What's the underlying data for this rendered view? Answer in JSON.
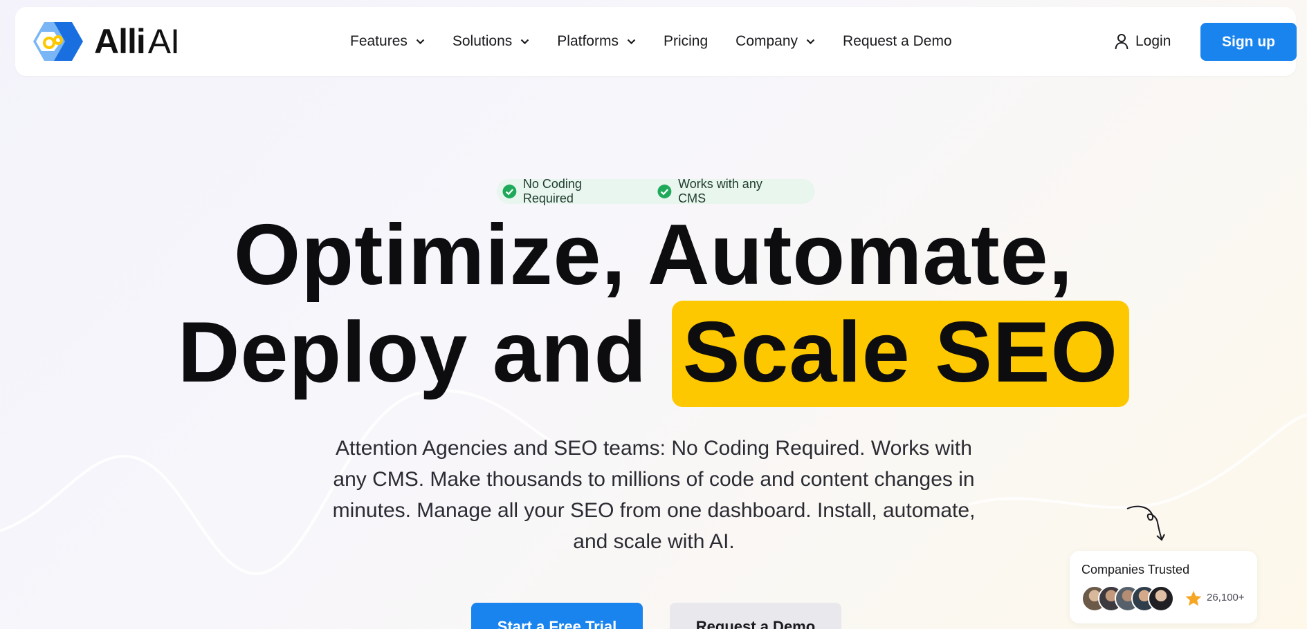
{
  "brand": {
    "name_main": "Alli",
    "name_ai": "AI"
  },
  "nav": {
    "items": [
      {
        "label": "Features",
        "has_dropdown": true
      },
      {
        "label": "Solutions",
        "has_dropdown": true
      },
      {
        "label": "Platforms",
        "has_dropdown": true
      },
      {
        "label": "Pricing",
        "has_dropdown": false
      },
      {
        "label": "Company",
        "has_dropdown": true
      },
      {
        "label": "Request a Demo",
        "has_dropdown": false
      }
    ],
    "login_label": "Login",
    "signup_label": "Sign up"
  },
  "badges": [
    {
      "label": "No Coding Required",
      "icon": "check-circle-icon"
    },
    {
      "label": "Works with any CMS",
      "icon": "check-circle-icon"
    }
  ],
  "hero": {
    "line1": "Optimize, Automate,",
    "line2_plain": "Deploy and",
    "line2_highlight": "Scale SEO",
    "subtitle": "Attention Agencies and SEO teams: No Coding Required. Works with any CMS. Make thousands to millions of code and content changes in minutes. Manage all your SEO from one dashboard. Install, automate, and scale with AI.",
    "cta_primary": "Start a Free Trial",
    "cta_secondary": "Request a Demo"
  },
  "trust": {
    "title": "Companies Trusted",
    "count": "26,100+",
    "avatar_count": 5
  },
  "colors": {
    "accent_blue": "#1a84ee",
    "highlight_yellow": "#fdc800",
    "check_green": "#1faa5b",
    "star_orange": "#f6a623"
  }
}
